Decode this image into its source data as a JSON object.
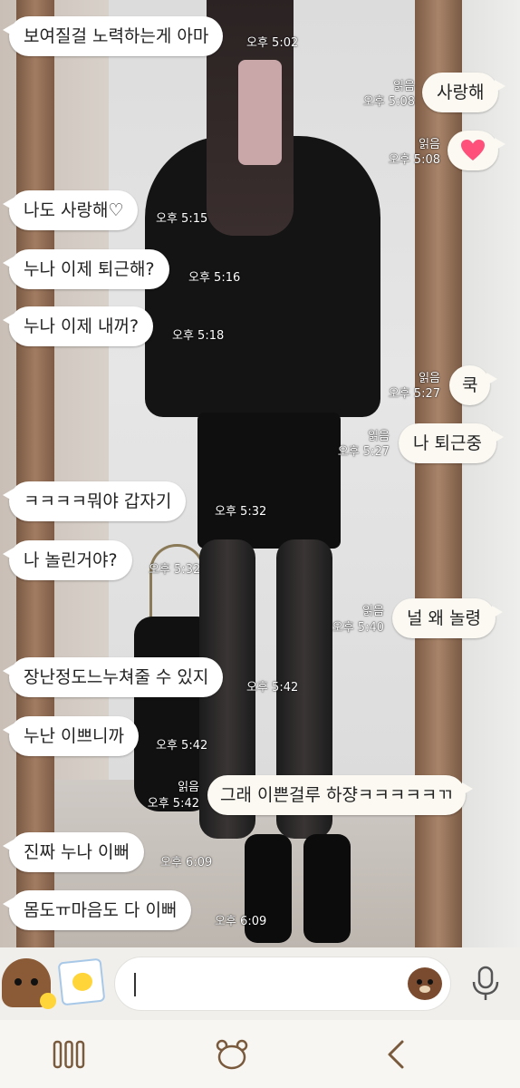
{
  "messages": [
    {
      "dir": "in",
      "text": "보여질걸 노력하는게 아마",
      "time": "오후 5:02",
      "read": ""
    },
    {
      "dir": "out",
      "text": "사랑해",
      "time": "오후 5:08",
      "read": "읽음"
    },
    {
      "dir": "out",
      "text": "",
      "emoji": "heart",
      "time": "오후 5:08",
      "read": "읽음"
    },
    {
      "dir": "in",
      "text": "나도 사랑해♡",
      "time": "오후 5:15",
      "read": ""
    },
    {
      "dir": "in",
      "text": "누나 이제 퇴근해?",
      "time": "오후 5:16",
      "read": ""
    },
    {
      "dir": "in",
      "text": "누나 이제 내꺼?",
      "time": "오후 5:18",
      "read": ""
    },
    {
      "dir": "out",
      "text": "쿡",
      "time": "오후 5:27",
      "read": "읽음"
    },
    {
      "dir": "out",
      "text": "나 퇴근중",
      "time": "오후 5:27",
      "read": "읽음"
    },
    {
      "dir": "in",
      "text": "ㅋㅋㅋㅋ뭐야 갑자기",
      "time": "오후 5:32",
      "read": ""
    },
    {
      "dir": "in",
      "text": "나 놀린거야?",
      "time": "오후 5:32",
      "read": ""
    },
    {
      "dir": "out",
      "text": "널 왜 놀령",
      "time": "오후 5:40",
      "read": "읽음"
    },
    {
      "dir": "in",
      "text": "장난정도느누쳐줄 수 있지",
      "time": "오후 5:42",
      "read": ""
    },
    {
      "dir": "in",
      "text": "누난 이쁘니까",
      "time": "오후 5:42",
      "read": ""
    },
    {
      "dir": "out",
      "text": "그래 이쁜걸루 하쟝ㅋㅋㅋㅋㅋㄲ",
      "time": "오후 5:42",
      "read": "읽음"
    },
    {
      "dir": "in",
      "text": "진짜 누나 이뻐",
      "time": "오후 6:09",
      "read": ""
    },
    {
      "dir": "in",
      "text": "몸도ㅠ마음도 다 이뻐",
      "time": "오후 6:09",
      "read": ""
    }
  ],
  "input": {
    "value": "",
    "placeholder": ""
  },
  "icons": {
    "emoji_panel": "brown-bear-sticker-icon",
    "sticker": "chick-photo-sticker-icon",
    "emoticon": "bear-emoticon-icon",
    "mic": "microphone-icon",
    "nav_recent": "recent-apps-icon",
    "nav_home": "home-bear-icon",
    "nav_back": "back-icon"
  },
  "colors": {
    "bubble_in": "#ffffff",
    "bubble_out": "#fbf9f2",
    "heart": "#ff4f7b",
    "input_bar": "#f0efec",
    "nav_bar": "#f7f6f3"
  }
}
